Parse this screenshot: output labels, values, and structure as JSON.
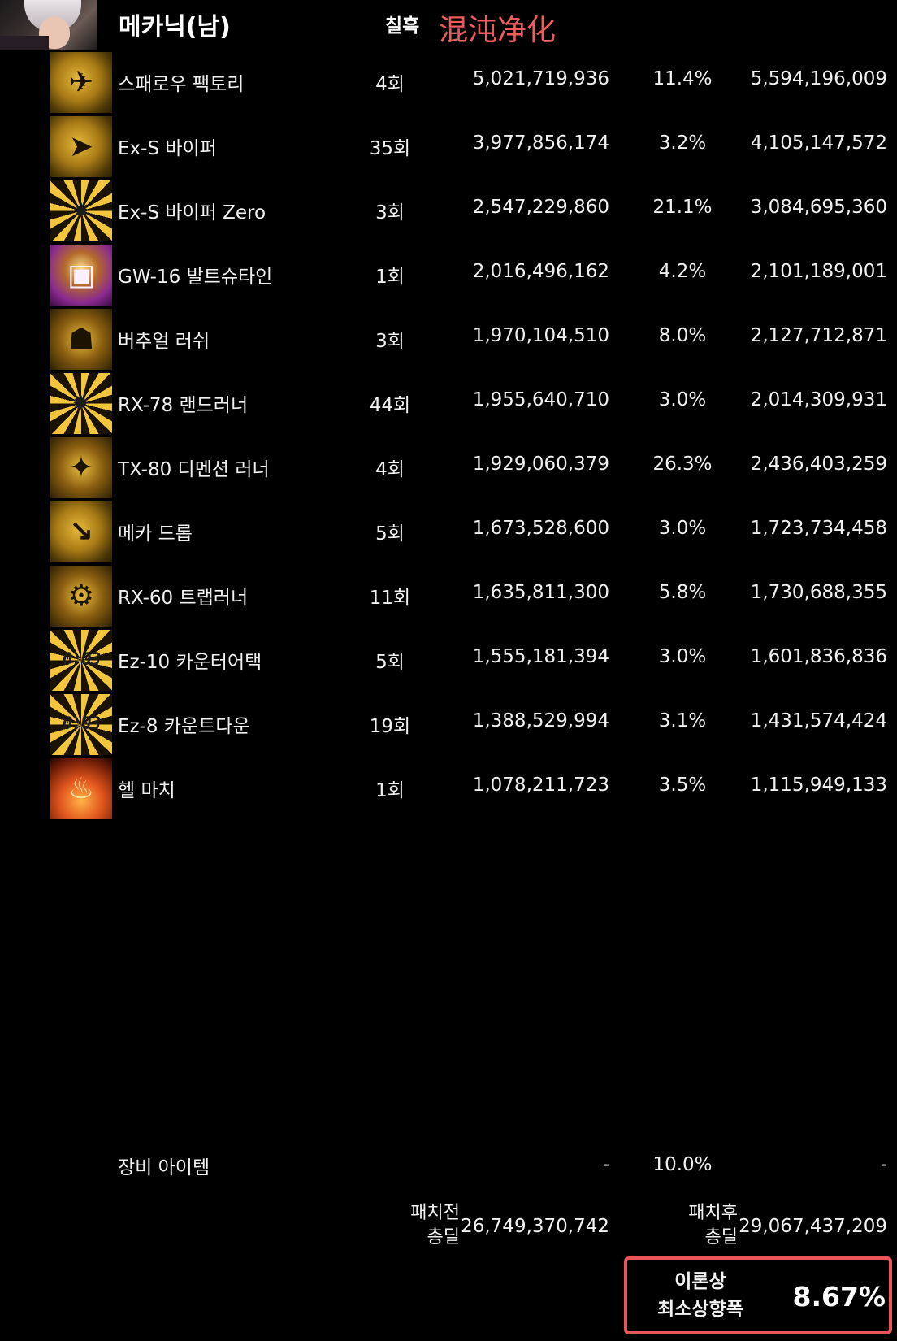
{
  "header": {
    "title": "메카닉(남)",
    "count_col": "칠흑",
    "tag": "混沌净化",
    "accent_color": "#f05b5b"
  },
  "skills": [
    {
      "name": "스패로우 팩토리",
      "count": "4회",
      "before": "5,021,719,936",
      "pct": "11.4%",
      "after": "5,594,196,009",
      "icon": "sparrow-factory-icon"
    },
    {
      "name": "Ex-S 바이퍼",
      "count": "35회",
      "before": "3,977,856,174",
      "pct": "3.2%",
      "after": "4,105,147,572",
      "icon": "ex-s-viper-icon"
    },
    {
      "name": "Ex-S 바이퍼 Zero",
      "count": "3회",
      "before": "2,547,229,860",
      "pct": "21.1%",
      "after": "3,084,695,360",
      "icon": "ex-s-viper-zero-icon"
    },
    {
      "name": "GW-16 발트슈타인",
      "count": "1회",
      "before": "2,016,496,162",
      "pct": "4.2%",
      "after": "2,101,189,001",
      "icon": "gw-16-waldstein-icon"
    },
    {
      "name": "버추얼 러쉬",
      "count": "3회",
      "before": "1,970,104,510",
      "pct": "8.0%",
      "after": "2,127,712,871",
      "icon": "virtual-rush-icon"
    },
    {
      "name": "RX-78 랜드러너",
      "count": "44회",
      "before": "1,955,640,710",
      "pct": "3.0%",
      "after": "2,014,309,931",
      "icon": "rx-78-landrunner-icon"
    },
    {
      "name": "TX-80 디멘션 러너",
      "count": "4회",
      "before": "1,929,060,379",
      "pct": "26.3%",
      "after": "2,436,403,259",
      "icon": "tx-80-dimension-runner-icon"
    },
    {
      "name": "메카 드롭",
      "count": "5회",
      "before": "1,673,528,600",
      "pct": "3.0%",
      "after": "1,723,734,458",
      "icon": "mecha-drop-icon"
    },
    {
      "name": "RX-60 트랩러너",
      "count": "11회",
      "before": "1,635,811,300",
      "pct": "5.8%",
      "after": "1,730,688,355",
      "icon": "rx-60-traprunner-icon"
    },
    {
      "name": "Ez-10 카운터어택",
      "count": "5회",
      "before": "1,555,181,394",
      "pct": "3.0%",
      "after": "1,601,836,836",
      "icon": "ez-10-counterattack-icon",
      "timer": "0:03"
    },
    {
      "name": "Ez-8 카운트다운",
      "count": "19회",
      "before": "1,388,529,994",
      "pct": "3.1%",
      "after": "1,431,574,424",
      "icon": "ez-8-countdown-icon",
      "timer": "0:03"
    },
    {
      "name": "헬 마치",
      "count": "1회",
      "before": "1,078,211,723",
      "pct": "3.5%",
      "after": "1,115,949,133",
      "icon": "hell-march-icon"
    }
  ],
  "equipment": {
    "label": "장비 아이템",
    "before": "-",
    "pct": "10.0%",
    "after": "-"
  },
  "totals": {
    "before_label_line1": "패치전",
    "before_label_line2": "총딜",
    "before_value": "26,749,370,742",
    "after_label_line1": "패치후",
    "after_label_line2": "총딜",
    "after_value": "29,067,437,209"
  },
  "result": {
    "label_line1": "이론상",
    "label_line2": "최소상향폭",
    "value": "8.67%",
    "border_color": "#e8565a"
  }
}
